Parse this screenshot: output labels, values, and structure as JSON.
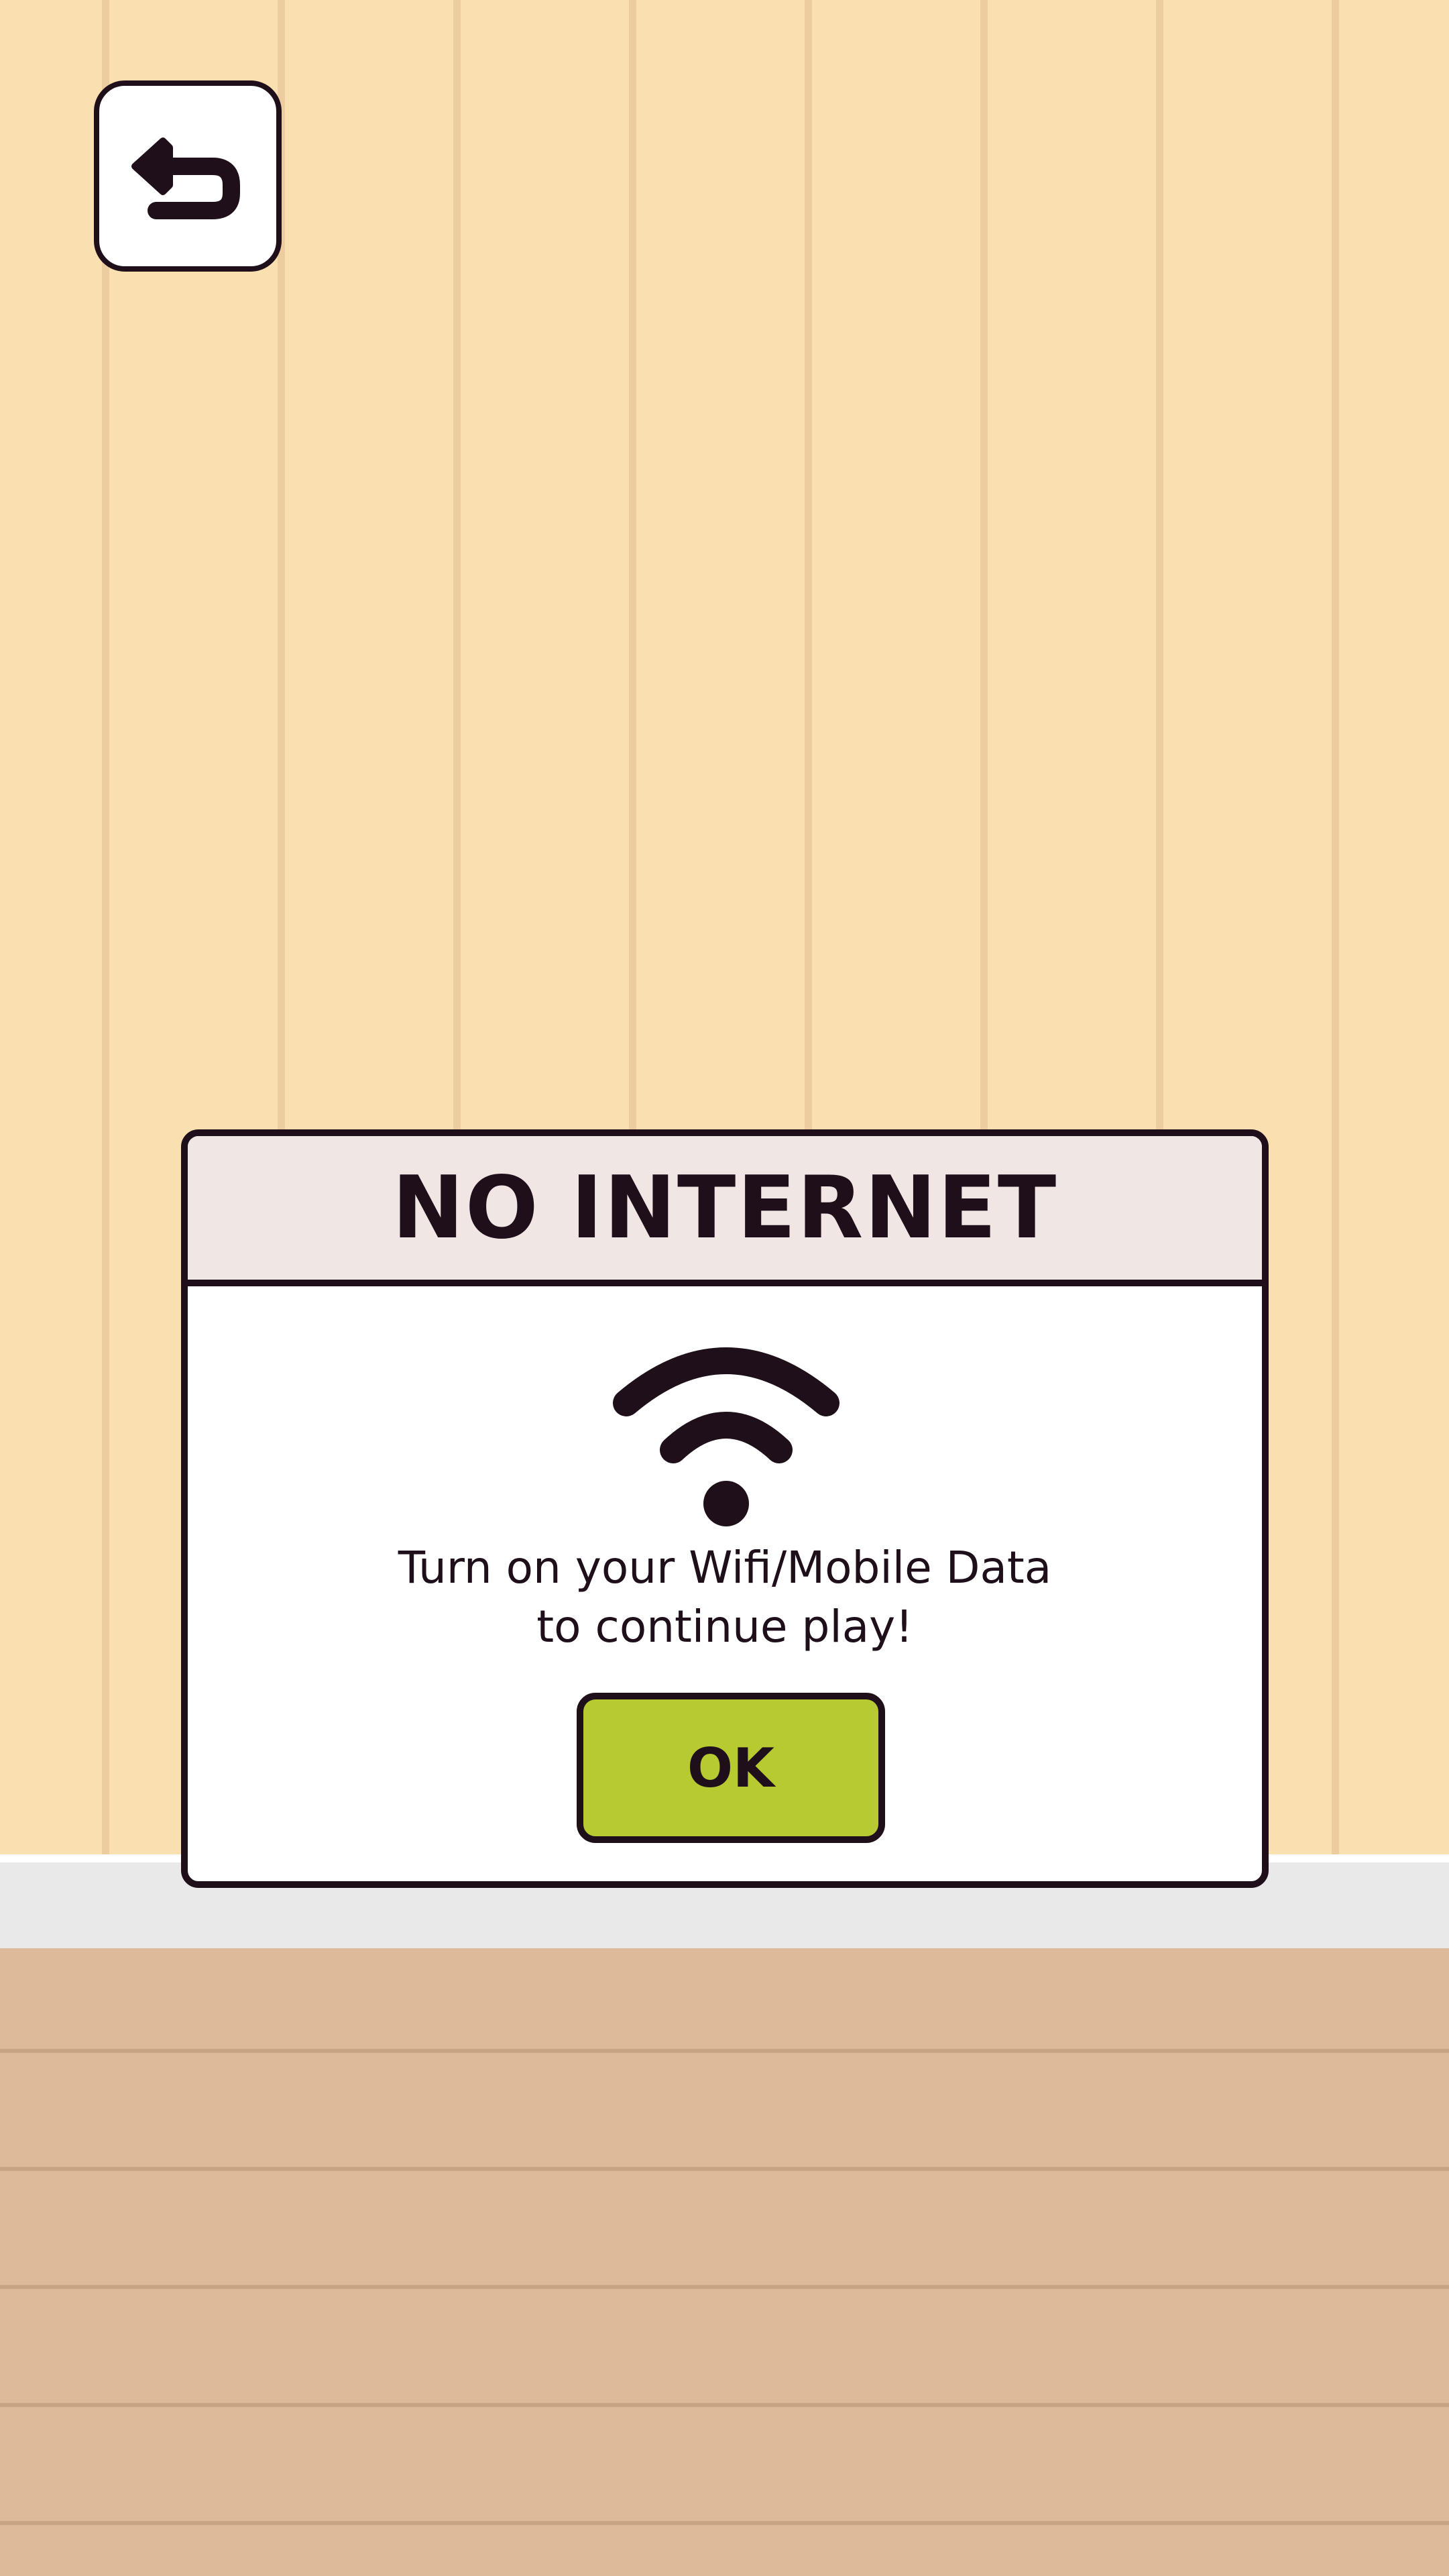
{
  "colors": {
    "wall": "#fadfb1",
    "wall_stripe": "#edcc9f",
    "baseboard": "#e9e9e9",
    "floor": "#ddbb9a",
    "floor_line": "#c9a482",
    "dialog_header": "#f0e6e4",
    "dialog_body": "#ffffff",
    "outline": "#1e0f1b",
    "ok_button": "#b8ca31"
  },
  "back_button": {
    "icon": "back-arrow-icon"
  },
  "dialog": {
    "title": "NO INTERNET",
    "icon": "wifi-icon",
    "message_line1": "Turn on your Wifi/Mobile Data",
    "message_line2": "to continue play!",
    "ok_label": "OK"
  }
}
